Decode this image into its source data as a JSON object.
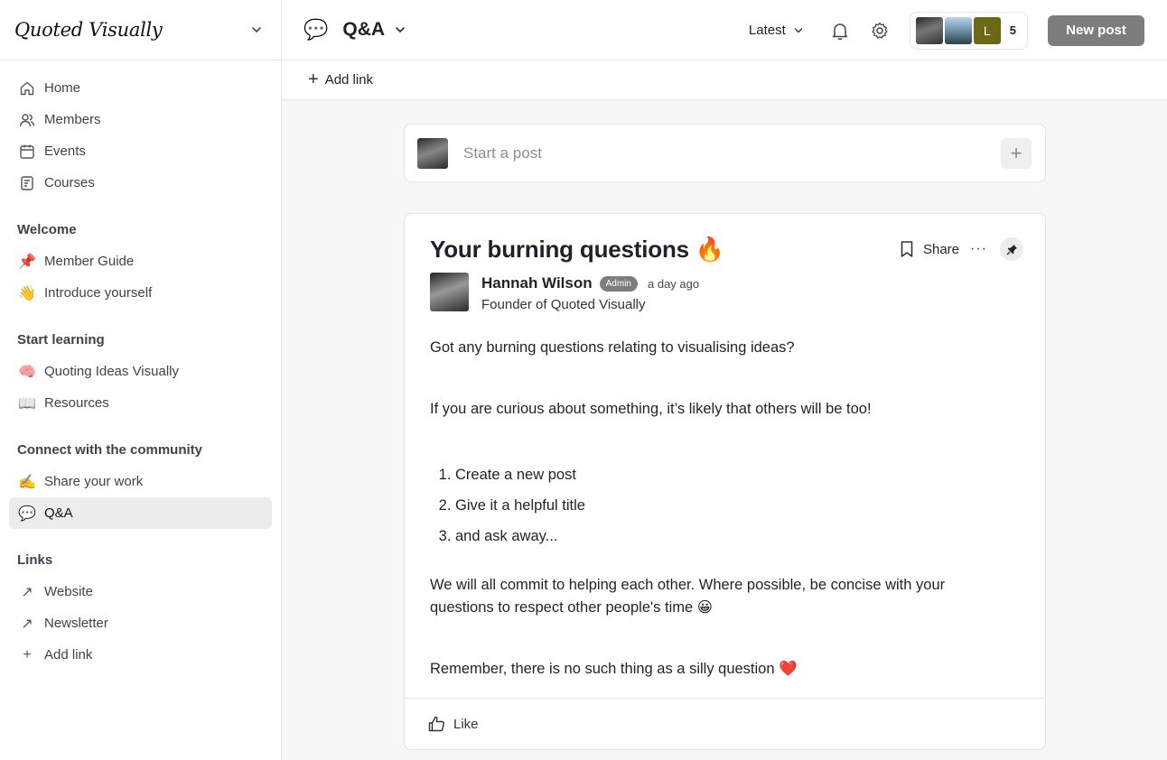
{
  "brand": {
    "name": "Quoted Visually"
  },
  "sidebar": {
    "main": [
      {
        "label": "Home",
        "icon": "home-icon"
      },
      {
        "label": "Members",
        "icon": "members-icon"
      },
      {
        "label": "Events",
        "icon": "calendar-icon"
      },
      {
        "label": "Courses",
        "icon": "courses-icon"
      }
    ],
    "sections": {
      "welcome": {
        "title": "Welcome",
        "items": [
          {
            "label": "Member Guide",
            "emoji": "📌"
          },
          {
            "label": "Introduce yourself",
            "emoji": "👋"
          }
        ]
      },
      "learning": {
        "title": "Start learning",
        "items": [
          {
            "label": "Quoting Ideas Visually",
            "emoji": "🧠"
          },
          {
            "label": "Resources",
            "emoji": "📖"
          }
        ]
      },
      "community": {
        "title": "Connect with the community",
        "items": [
          {
            "label": "Share your work",
            "emoji": "✍️"
          },
          {
            "label": "Q&A",
            "emoji": "💬"
          }
        ]
      },
      "links": {
        "title": "Links",
        "items": [
          {
            "label": "Website",
            "icon": "↗"
          },
          {
            "label": "Newsletter",
            "icon": "↗"
          },
          {
            "label": "Add link",
            "icon": "+"
          }
        ]
      }
    }
  },
  "topbar": {
    "space_title": "Q&A",
    "space_emoji": "💬",
    "sort_label": "Latest",
    "member_avatar_letter": "L",
    "member_count": "5",
    "new_post_label": "New post"
  },
  "subbar": {
    "add_link_label": "Add link"
  },
  "composer": {
    "placeholder": "Start a post"
  },
  "post": {
    "title": "Your burning questions 🔥",
    "share_label": "Share",
    "author_name": "Hannah Wilson",
    "author_badge": "Admin",
    "time": "a day ago",
    "author_role": "Founder of Quoted Visually",
    "p1": "Got any burning questions relating to visualising ideas?",
    "p2": "If you are curious about something, it’s likely that others will be too!",
    "steps": [
      "Create a new post",
      "Give it a helpful title",
      "and ask away..."
    ],
    "p3": "We will all commit to helping each other. Where possible, be concise with your questions to respect other people's time 😀",
    "p4": "Remember, there is no such thing as a silly question ❤️",
    "like_label": "Like"
  },
  "colors": {
    "active_bg": "#ececed",
    "button_gray": "#7d7d7d",
    "border": "#e4e4e7"
  }
}
